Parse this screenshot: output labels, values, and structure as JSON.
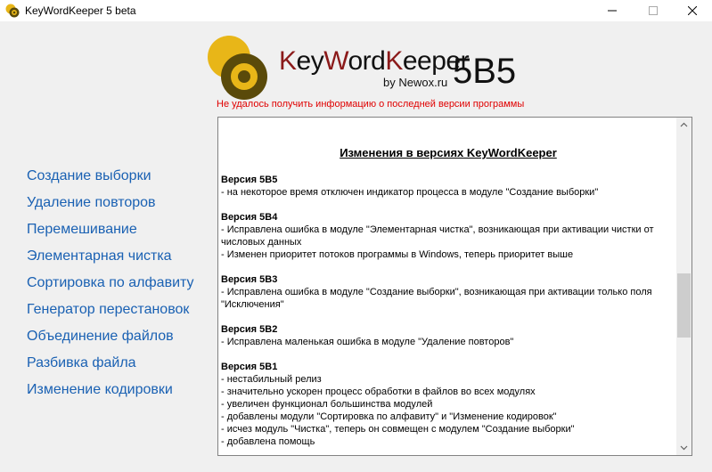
{
  "window": {
    "title": "KeyWordKeeper 5 beta"
  },
  "header": {
    "brand_k": "K",
    "brand_ey": "ey",
    "brand_w": "W",
    "brand_ord": "ord",
    "brand_k2": "K",
    "brand_eeper": "eeper",
    "byline": "by Newox.ru",
    "version": "5B5",
    "update_message": "Не удалось получить информацию о последней версии программы"
  },
  "menu": {
    "items": [
      "Создание выборки",
      "Удаление повторов",
      "Перемешивание",
      "Элементарная чистка",
      "Сортировка по алфавиту",
      "Генератор перестановок",
      "Объединение файлов",
      "Разбивка файла",
      "Изменение кодировки"
    ]
  },
  "changelog": {
    "heading": "Изменения в версиях KeyWordKeeper",
    "lines": [
      {
        "text": "Версия 5B5",
        "bold": true
      },
      {
        "text": "- на некоторое время отключен индикатор процесса в модуле \"Создание выборки\"",
        "bold": false
      },
      {
        "text": "Версия 5B4",
        "bold": true
      },
      {
        "text": "- Исправлена ошибка в модуле \"Элементарная чистка\", возникающая при активации чистки от",
        "bold": false
      },
      {
        "text": "числовых данных",
        "bold": false
      },
      {
        "text": "- Изменен приоритет потоков программы в Windows, теперь приоритет выше",
        "bold": false
      },
      {
        "text": "Версия 5B3",
        "bold": true
      },
      {
        "text": "- Исправлена ошибка в модуле \"Создание выборки\", возникающая при активации только поля",
        "bold": false
      },
      {
        "text": "\"Исключения\"",
        "bold": false
      },
      {
        "text": "Версия 5B2",
        "bold": true
      },
      {
        "text": "- Исправлена маленькая ошибка в модуле \"Удаление повторов\"",
        "bold": false
      },
      {
        "text": "Версия 5B1",
        "bold": true
      },
      {
        "text": "- нестабильный релиз",
        "bold": false
      },
      {
        "text": "- значительно ускорен процесс обработки в файлов во всех модулях",
        "bold": false
      },
      {
        "text": "- увеличен функционал большинства модулей",
        "bold": false
      },
      {
        "text": "- добавлены модули \"Сортировка по алфавиту\" и \"Изменение кодировок\"",
        "bold": false
      },
      {
        "text": "- исчез модуль \"Чистка\", теперь он совмещен с модулем \"Создание выборки\"",
        "bold": false
      },
      {
        "text": "- добавлена помощь",
        "bold": false
      }
    ]
  },
  "icons": {
    "minimize": "minimize-icon",
    "maximize": "maximize-icon",
    "close": "close-icon",
    "scroll_up": "chevron-up-icon",
    "scroll_down": "chevron-down-icon"
  },
  "colors": {
    "menu_link": "#1a61b3",
    "error_text": "#e00000",
    "brand_accent": "#8b1a1a",
    "logo_gold": "#e8b618",
    "logo_dark": "#5a4a0a"
  }
}
